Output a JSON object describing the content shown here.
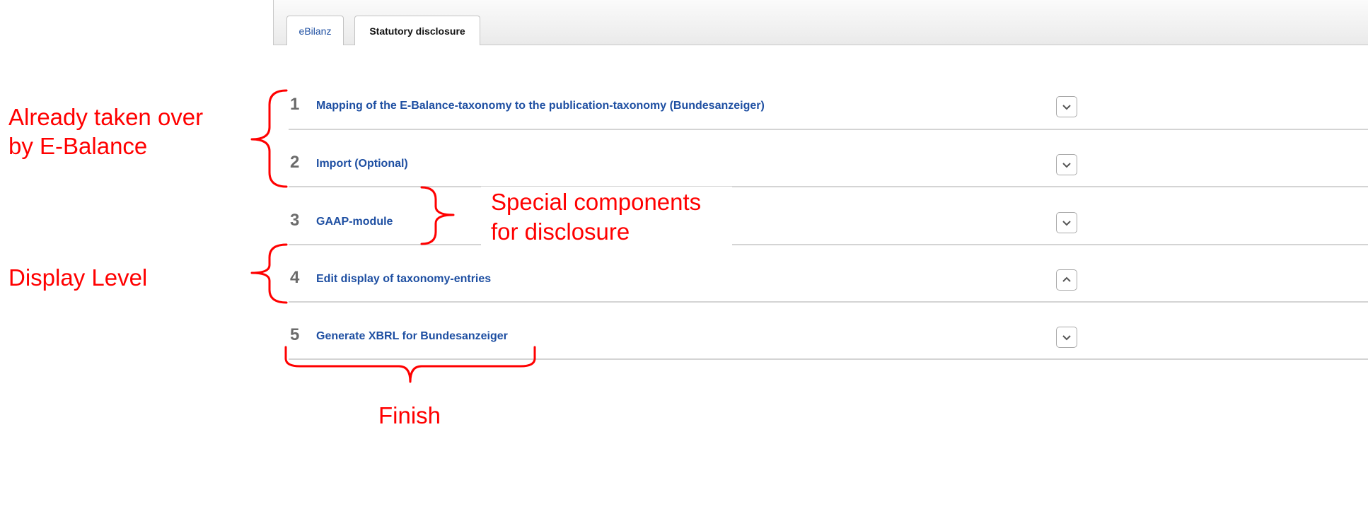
{
  "tabs": [
    {
      "label": "eBilanz",
      "active": false
    },
    {
      "label": "Statutory disclosure",
      "active": true
    }
  ],
  "steps": [
    {
      "number": "1",
      "label": "Mapping of the E-Balance-taxonomy to the publication-taxonomy (Bundesanzeiger)",
      "toggle_icon": "chevron-down-icon"
    },
    {
      "number": "2",
      "label": "Import (Optional)",
      "toggle_icon": "chevron-down-icon"
    },
    {
      "number": "3",
      "label": "GAAP-module",
      "toggle_icon": "chevron-down-icon"
    },
    {
      "number": "4",
      "label": "Edit display of taxonomy-entries",
      "toggle_icon": "chevron-up-icon"
    },
    {
      "number": "5",
      "label": "Generate XBRL for Bundesanzeiger",
      "toggle_icon": "chevron-down-icon"
    }
  ],
  "annotations": {
    "already_line1": "Already taken over",
    "already_line2": "by E-Balance",
    "special_line1": "Special components",
    "special_line2": "for disclosure",
    "display": "Display Level",
    "finish": "Finish"
  },
  "colors": {
    "annotation": "#ff0000",
    "link": "#1e4fa2",
    "number": "#6b6b6b"
  }
}
